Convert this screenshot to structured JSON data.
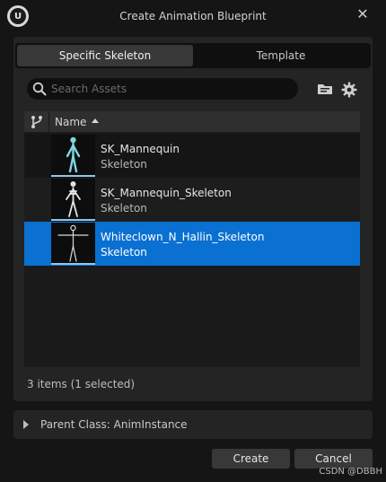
{
  "window": {
    "title": "Create Animation Blueprint",
    "close_glyph": "✕"
  },
  "tabs": [
    {
      "label": "Specific Skeleton",
      "active": true
    },
    {
      "label": "Template",
      "active": false
    }
  ],
  "search": {
    "placeholder": "Search Assets",
    "value": ""
  },
  "toolbar": {
    "folder_icon": "folder-icon",
    "settings_icon": "gear-icon"
  },
  "list": {
    "column_name": "Name",
    "sort": "ascending",
    "items": [
      {
        "name": "SK_Mannequin",
        "type": "Skeleton",
        "selected": false
      },
      {
        "name": "SK_Mannequin_Skeleton",
        "type": "Skeleton",
        "selected": false
      },
      {
        "name": "Whiteclown_N_Hallin_Skeleton",
        "type": "Skeleton",
        "selected": true
      }
    ]
  },
  "status": "3 items (1 selected)",
  "parent_class": {
    "label": "Parent Class: AnimInstance",
    "expanded": false
  },
  "buttons": {
    "create": "Create",
    "cancel": "Cancel"
  },
  "watermark": "CSDN @DBBH",
  "colors": {
    "selection": "#0a70d2",
    "thumb_accent": "#8fc7ea",
    "background": "#151515",
    "panel": "#242424"
  }
}
